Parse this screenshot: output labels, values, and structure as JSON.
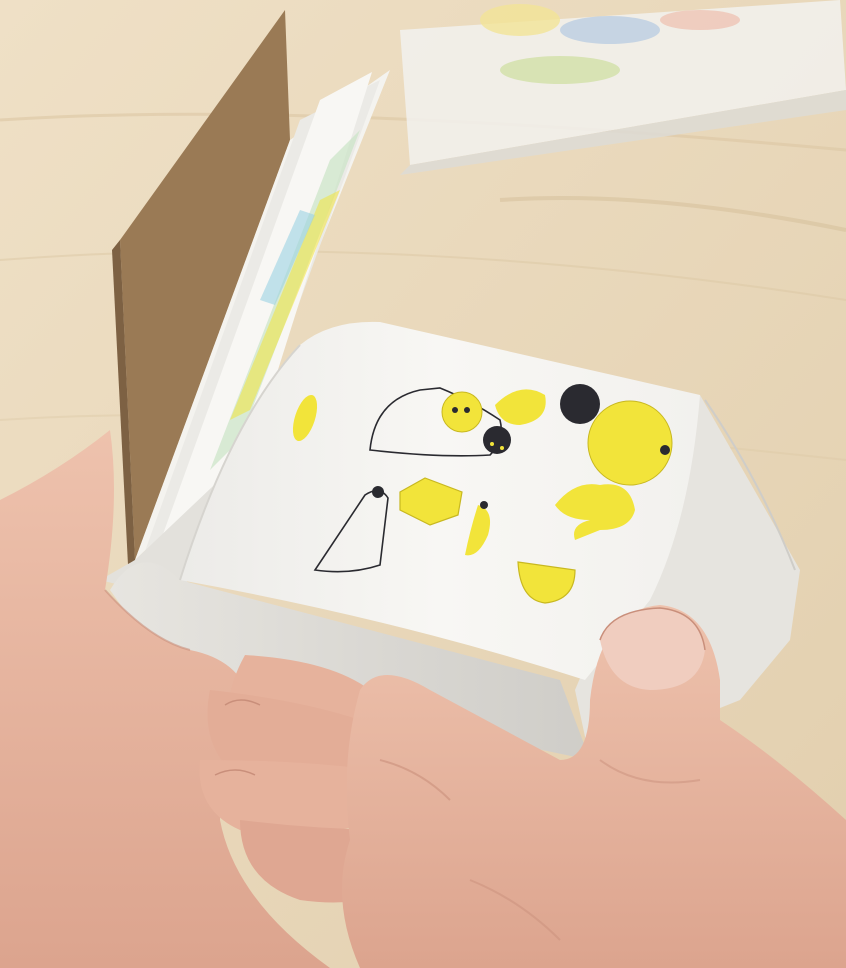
{
  "scene": {
    "subject": "flipbook",
    "colors": {
      "table": "#e9d9bf",
      "table_grain": "#d9c4a2",
      "page": "#f6f5f2",
      "page_edge": "#dcdad5",
      "cover": "#9a7a55",
      "ink_yellow": "#f2e43a",
      "ink_black": "#2a2a30",
      "skin": "#e8b9a4",
      "skin_shadow": "#c98f7b",
      "nail": "#f0cdbf"
    }
  }
}
